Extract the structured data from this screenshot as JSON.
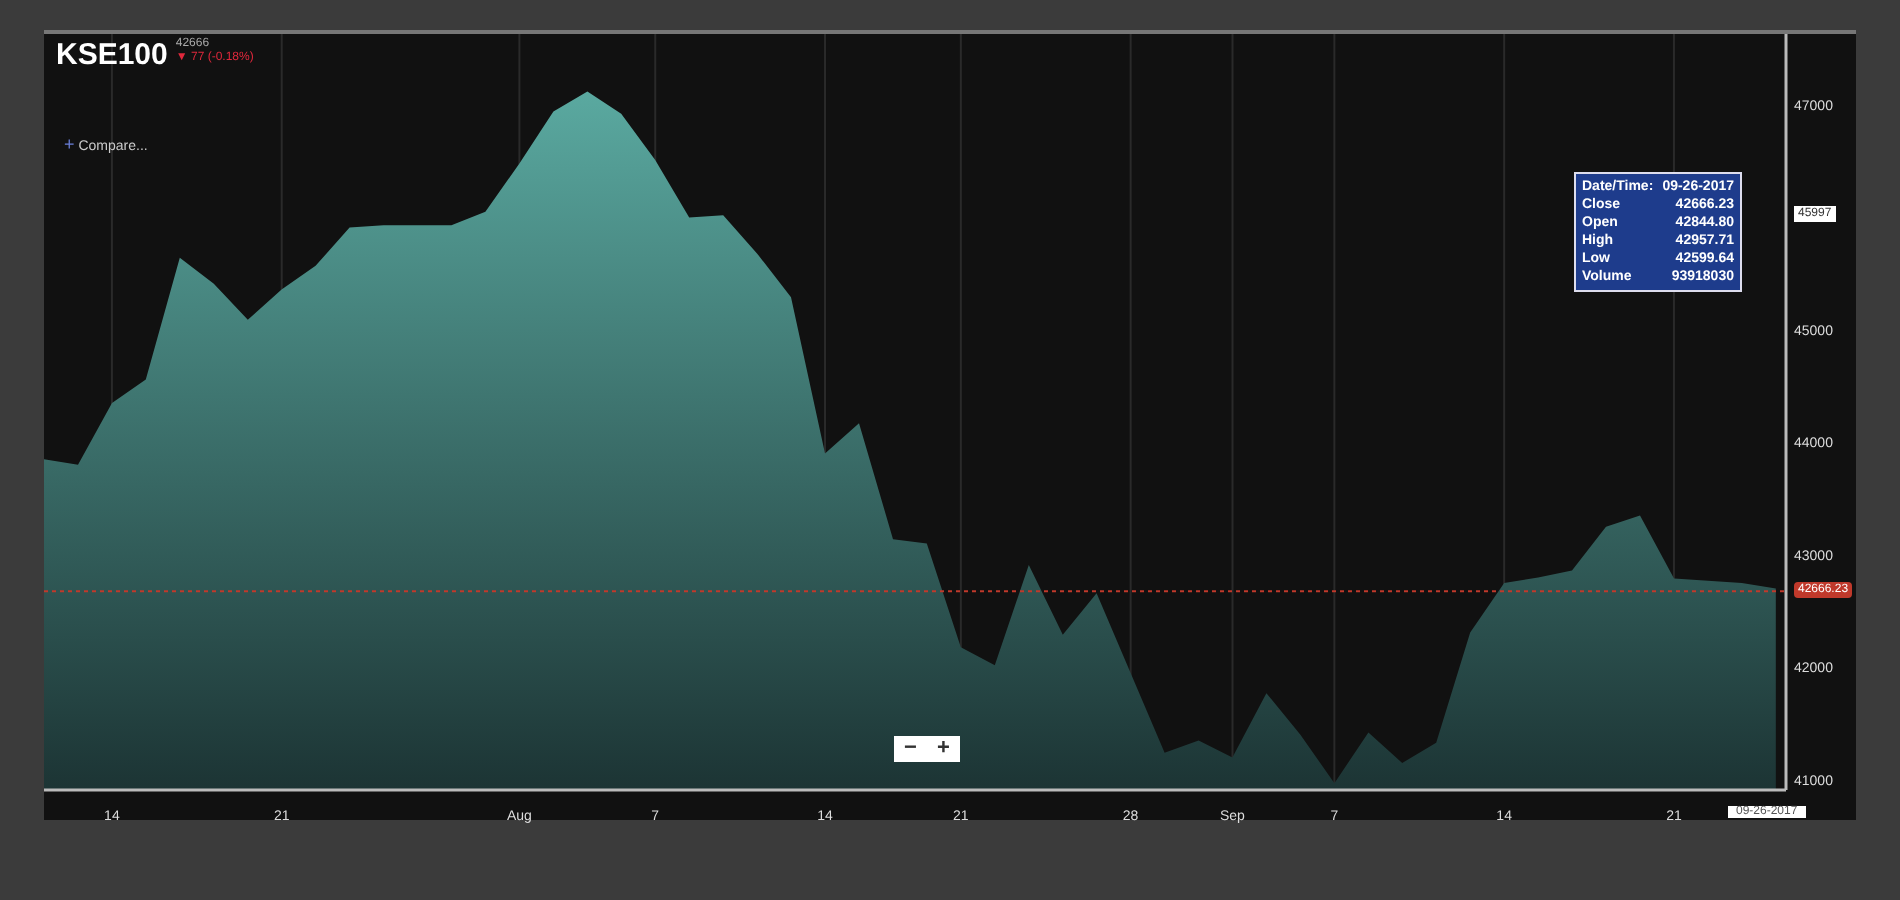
{
  "header": {
    "symbol": "KSE100",
    "price": "42666",
    "change": "▼ 77 (-0.18%)"
  },
  "compare_button": {
    "icon": "+",
    "label": "Compare..."
  },
  "chart": {
    "chart_data": {
      "type": "area",
      "categories": [
        null,
        null,
        "14",
        null,
        null,
        null,
        null,
        "21",
        null,
        null,
        null,
        null,
        null,
        null,
        "Aug",
        null,
        null,
        null,
        "7",
        null,
        null,
        null,
        null,
        "14",
        null,
        null,
        null,
        "21",
        null,
        null,
        null,
        null,
        "28",
        null,
        null,
        "Sep",
        null,
        null,
        "7",
        null,
        null,
        null,
        null,
        "14",
        null,
        null,
        null,
        null,
        "21",
        null,
        null,
        null
      ],
      "series": [
        {
          "color": "#5aa9a0",
          "values": [
            43840,
            43790,
            44340,
            44550,
            45630,
            45400,
            45080,
            45350,
            45560,
            45900,
            45920,
            45920,
            45920,
            46040,
            46470,
            46930,
            47110,
            46910,
            46500,
            45990,
            46010,
            45670,
            45280,
            43890,
            44160,
            43130,
            43090,
            42170,
            42010,
            42900,
            42280,
            42650,
            41940,
            41230,
            41340,
            41190,
            41760,
            41390,
            40960,
            41410,
            41140,
            41320,
            42300,
            42740,
            42790,
            42850,
            43240,
            43340,
            42780,
            42760,
            42740,
            42690
          ]
        }
      ],
      "ylim": [
        40900,
        47620
      ],
      "yticks": [
        41000,
        42000,
        43000,
        44000,
        45000,
        47000
      ],
      "grid": true,
      "ref_lines": [
        {
          "axis": "y",
          "value": 42666.23,
          "label": "42666.23",
          "color": "#c0392b"
        }
      ]
    },
    "crosshair_label": "45997",
    "date_label": "09-26-2017"
  },
  "tooltip": {
    "rows": [
      {
        "label": "Date/Time:",
        "value": "09-26-2017"
      },
      {
        "label": "Close",
        "value": "42666.23"
      },
      {
        "label": "Open",
        "value": "42844.80"
      },
      {
        "label": "High",
        "value": "42957.71"
      },
      {
        "label": "Low",
        "value": "42599.64"
      },
      {
        "label": "Volume",
        "value": "93918030"
      }
    ]
  },
  "zoom_controls": [
    "−",
    "+"
  ]
}
